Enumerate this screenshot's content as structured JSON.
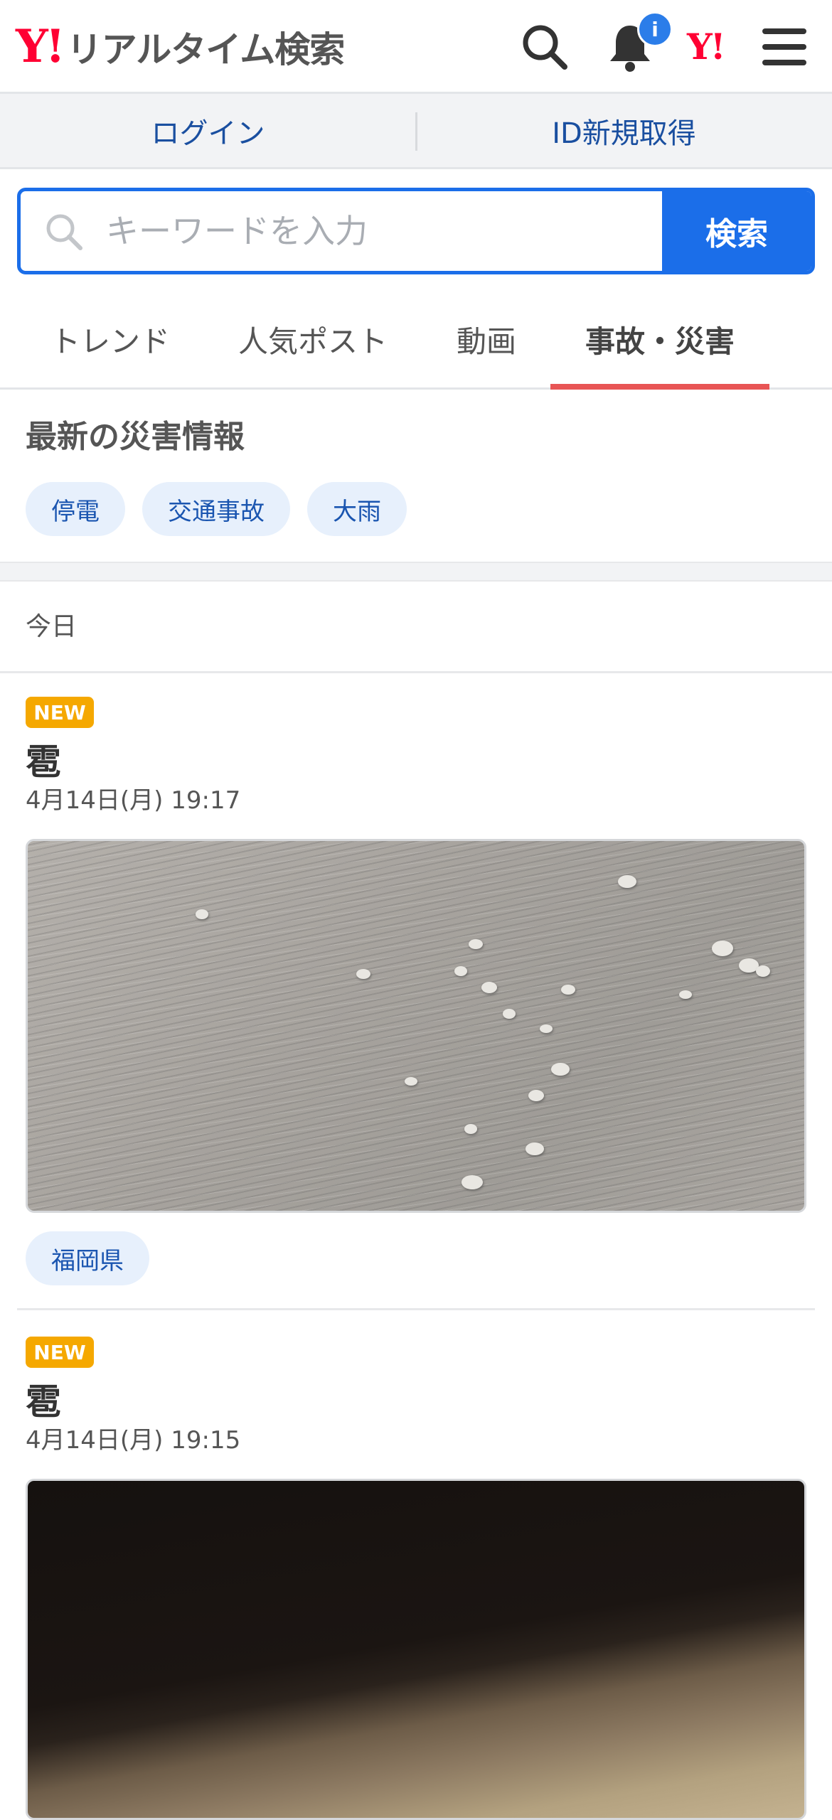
{
  "header": {
    "logo_mark": "Y!",
    "logo_text": "リアルタイム検索",
    "notification_badge": "i",
    "yahoo_mark": "Y!"
  },
  "login_bar": {
    "login": "ログイン",
    "register": "ID新規取得"
  },
  "search": {
    "placeholder": "キーワードを入力",
    "button": "検索"
  },
  "tabs": [
    {
      "label": "トレンド",
      "active": false
    },
    {
      "label": "人気ポスト",
      "active": false
    },
    {
      "label": "動画",
      "active": false
    },
    {
      "label": "事故・災害",
      "active": true
    }
  ],
  "disaster": {
    "title": "最新の災害情報",
    "chips": [
      "停電",
      "交通事故",
      "大雨"
    ]
  },
  "section_label": "今日",
  "posts": [
    {
      "badge": "NEW",
      "title": "雹",
      "time": "4月14日(月) 19:17",
      "location": "福岡県"
    },
    {
      "badge": "NEW",
      "title": "雹",
      "time": "4月14日(月) 19:15"
    }
  ],
  "colors": {
    "accent_blue": "#1b6ee9",
    "tab_underline": "#e85555",
    "new_badge": "#f5a800",
    "yahoo_red": "#ff0033"
  }
}
